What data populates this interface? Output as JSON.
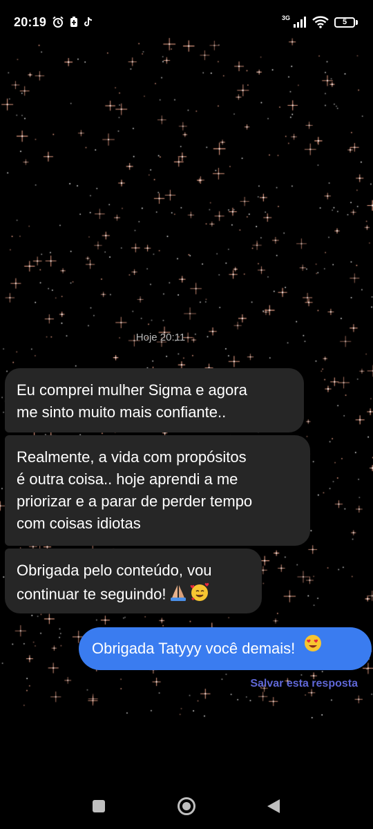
{
  "status_bar": {
    "time": "20:19",
    "network": "3G",
    "battery_level": "5",
    "icons": [
      "alarm-icon",
      "battery-saver-icon",
      "tiktok-icon",
      "signal-icon",
      "wifi-icon",
      "battery-icon"
    ]
  },
  "thread": {
    "timestamp": "Hoje 20:11",
    "received_messages": [
      {
        "lines": [
          "Eu comprei mulher Sigma e agora",
          "me sinto muito mais confiante.."
        ]
      },
      {
        "lines": [
          "Realmente, a vida com propósitos",
          "é outra coisa.. hoje aprendi a me",
          "priorizar e a parar de perder tempo",
          "com coisas idiotas"
        ]
      },
      {
        "lines": [
          "Obrigada pelo conteúdo, vou",
          "continuar te seguindo!"
        ]
      }
    ],
    "sent_message": "Obrigada Tatyyy você demais!",
    "save_reply_label": "Salvar esta resposta"
  },
  "colors": {
    "background": "#000000",
    "received_bubble": "#262626",
    "sent_bubble": "#3a7cf0",
    "save_reply": "#5f67d6",
    "star_warm": "#f4a78c",
    "star_white": "#ffffff"
  },
  "nav_bar": {
    "icons": [
      "recent-apps-icon",
      "home-icon",
      "back-icon"
    ]
  }
}
